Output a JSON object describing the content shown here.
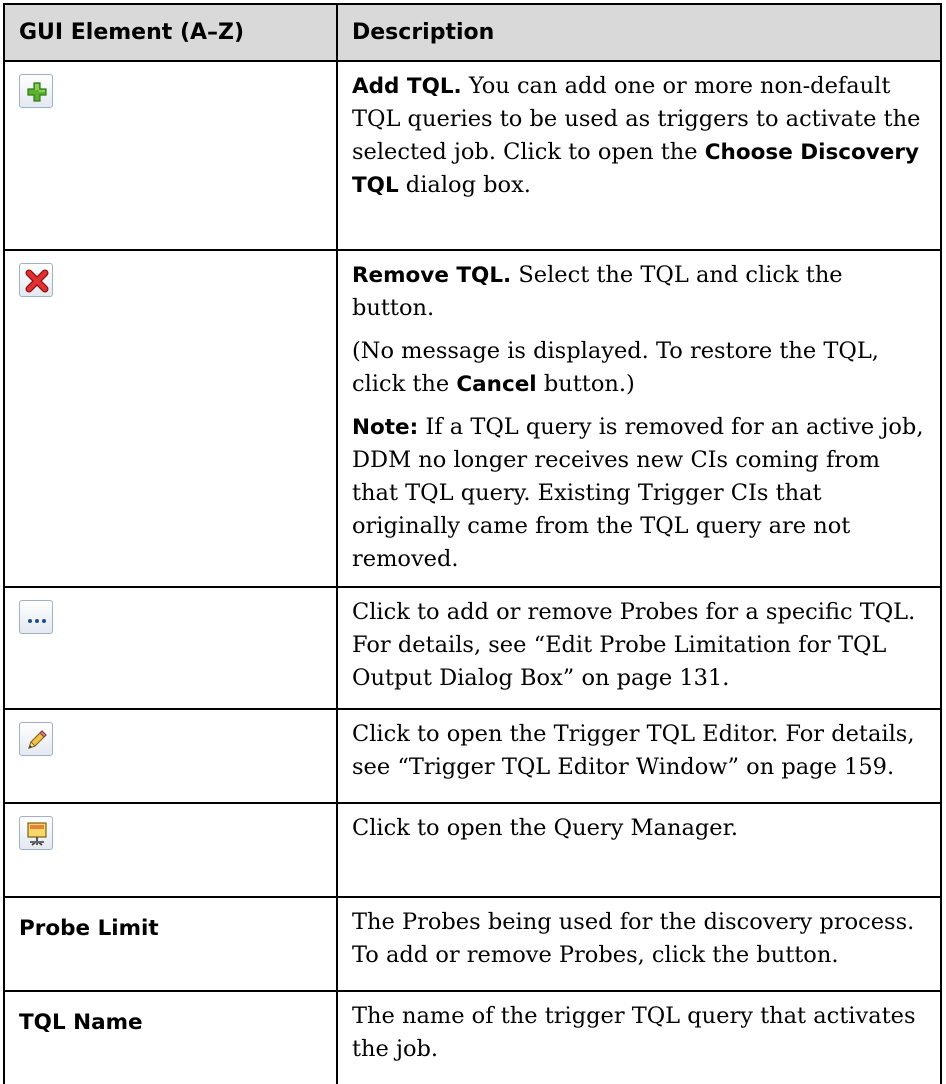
{
  "header": {
    "col1": "GUI Element (A–Z)",
    "col2": "Description"
  },
  "rows": [
    {
      "icon": "add-icon",
      "desc": {
        "b1": "Add TQL.",
        "t1": " You can add one or more non-default TQL queries to be used as triggers to activate the selected job. Click to open the ",
        "b2": "Choose Discovery TQL",
        "t2": " dialog box."
      }
    },
    {
      "icon": "remove-icon",
      "desc": {
        "b1": "Remove TQL.",
        "t1": " Select the TQL and click the button.",
        "p2_t1": "(No message is displayed. To restore the TQL, click the ",
        "p2_b1": "Cancel",
        "p2_t2": " button.)",
        "p3_b1": "Note:",
        "p3_t1": " If a TQL query is removed for an active job, DDM no longer receives new CIs coming from that TQL query. Existing Trigger CIs that originally came from the TQL query are not removed."
      }
    },
    {
      "icon": "ellipsis-icon",
      "desc": {
        "t1": "Click to add or remove Probes for a specific TQL. For details, see “Edit Probe Limitation for TQL Output Dialog Box” on page 131."
      }
    },
    {
      "icon": "pencil-icon",
      "desc": {
        "t1": "Click to open the Trigger TQL Editor. For details, see “Trigger TQL Editor Window” on page 159."
      }
    },
    {
      "icon": "query-manager-icon",
      "desc": {
        "t1": "Click to open the Query Manager."
      }
    },
    {
      "label": "Probe Limit",
      "desc": {
        "t1": "The Probes being used for the discovery process. To add or remove Probes, click the button."
      }
    },
    {
      "label": "TQL Name",
      "desc": {
        "t1": "The name of the trigger TQL query that activates the job."
      }
    }
  ]
}
